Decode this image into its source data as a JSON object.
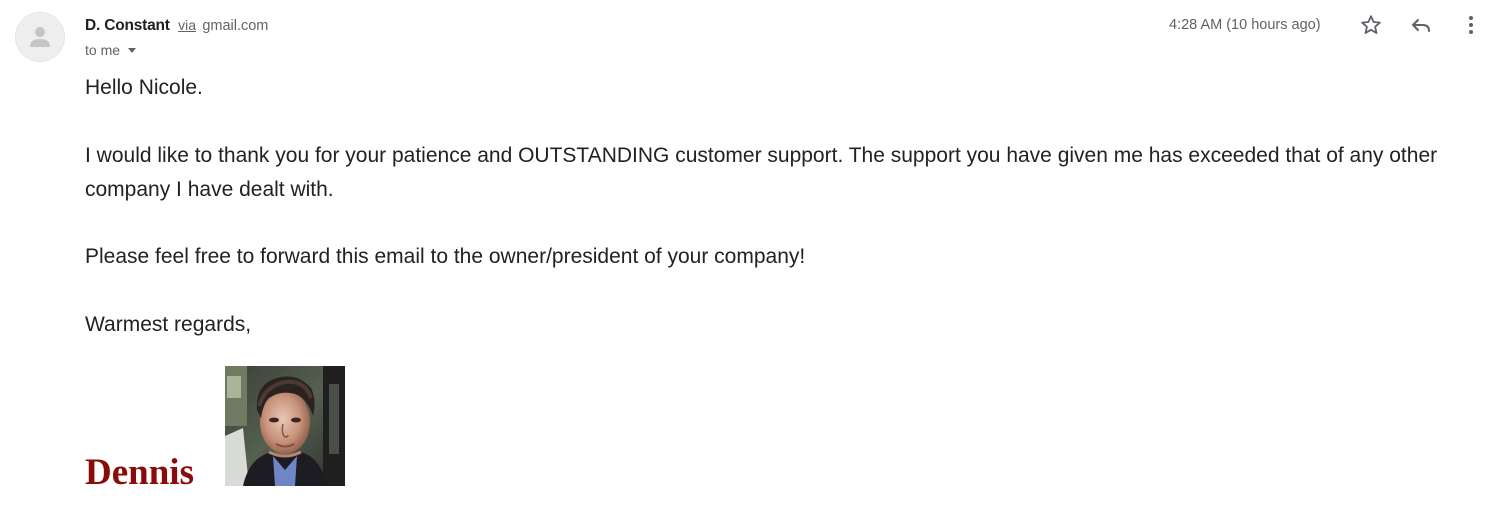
{
  "header": {
    "sender_name": "D. Constant",
    "via_label": "via",
    "sender_domain": "gmail.com",
    "recipient_label": "to me",
    "timestamp": "4:28 AM (10 hours ago)"
  },
  "icons": {
    "avatar": "default-avatar-icon",
    "star": "star-outline-icon",
    "reply": "reply-icon",
    "more": "more-vertical-icon",
    "recipient_toggle": "caret-down-icon"
  },
  "body": {
    "greeting": "Hello Nicole.",
    "paragraph1": "I would like to thank you for your patience and OUTSTANDING customer support. The support you have given me has exceeded that of any other company I have dealt with.",
    "paragraph2": "Please feel free to forward this email to the owner/president of your company!",
    "closing": "Warmest regards,"
  },
  "signature": {
    "name": "Dennis",
    "name_color": "#8b0a0a",
    "photo": "signature-portrait-photo"
  },
  "colors": {
    "text": "#222222",
    "muted": "#5f6368",
    "avatar_bg": "#eeeeee"
  }
}
